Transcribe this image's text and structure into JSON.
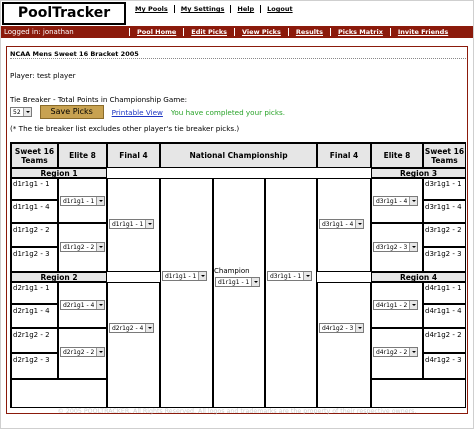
{
  "app": {
    "logo": "PoolTracker"
  },
  "topnav": [
    {
      "label": "My Pools"
    },
    {
      "label": "My Settings"
    },
    {
      "label": "Help"
    },
    {
      "label": "Logout"
    }
  ],
  "bar": {
    "logged_in": "Logged in: jonathan",
    "subnav": [
      {
        "label": "Pool Home"
      },
      {
        "label": "Edit Picks"
      },
      {
        "label": "View Picks"
      },
      {
        "label": "Results"
      },
      {
        "label": "Picks Matrix"
      },
      {
        "label": "Invite Friends"
      }
    ]
  },
  "pool": {
    "title": "NCAA Mens Sweet 16 Bracket 2005",
    "player": "Player: test player",
    "tiebreaker_label": "Tie Breaker - Total Points in Championship Game:",
    "tiebreaker_value": "52",
    "save_label": "Save Picks",
    "printable_label": "Printable View",
    "complete_msg": "You have completed your picks.",
    "tiebreaker_note": "(* The tie breaker list excludes other player's tie breaker picks.)"
  },
  "bracket": {
    "headers": {
      "sweet16_left": "Sweet 16 Teams",
      "elite8_left": "Elite 8",
      "final4_left": "Final 4",
      "championship": "National Championship",
      "final4_right": "Final 4",
      "elite8_right": "Elite 8",
      "sweet16_right": "Sweet 16 Teams"
    },
    "regions": [
      "Region 1",
      "Region 2",
      "Region 3",
      "Region 4"
    ],
    "teams": {
      "r1": [
        "d1r1g1 - 1",
        "d1r1g1 - 4",
        "d1r1g2 - 2",
        "d1r1g2 - 3"
      ],
      "r2": [
        "d2r1g1 - 1",
        "d2r1g1 - 4",
        "d2r1g2 - 2",
        "d2r1g2 - 3"
      ],
      "r3": [
        "d3r1g1 - 1",
        "d3r1g1 - 4",
        "d3r1g2 - 2",
        "d3r1g2 - 3"
      ],
      "r4": [
        "d4r1g1 - 1",
        "d4r1g1 - 4",
        "d4r1g2 - 2",
        "d4r1g2 - 3"
      ]
    },
    "elite8": {
      "r1": [
        "d1r1g1 - 1",
        "d1r1g2 - 2"
      ],
      "r2": [
        "d2r1g1 - 4",
        "d2r1g2 - 2"
      ],
      "r3": [
        "d3r1g1 - 4",
        "d3r1g2 - 3"
      ],
      "r4": [
        "d4r1g1 - 2",
        "d4r1g2 - 2"
      ]
    },
    "final4": {
      "r1": "d1r1g1 - 1",
      "r2": "d2r1g2 - 4",
      "r3": "d3r1g1 - 4",
      "r4": "d4r1g2 - 3"
    },
    "championship": {
      "left": "d1r1g1 - 1",
      "right": "d3r1g1 - 1",
      "champion_label": "Champion",
      "champion": "d1r1g1 - 1"
    }
  },
  "footer": "© 2005 POOLTRACKER. All Rights Reserved. All logos and trademarks are the property of their respective owners."
}
